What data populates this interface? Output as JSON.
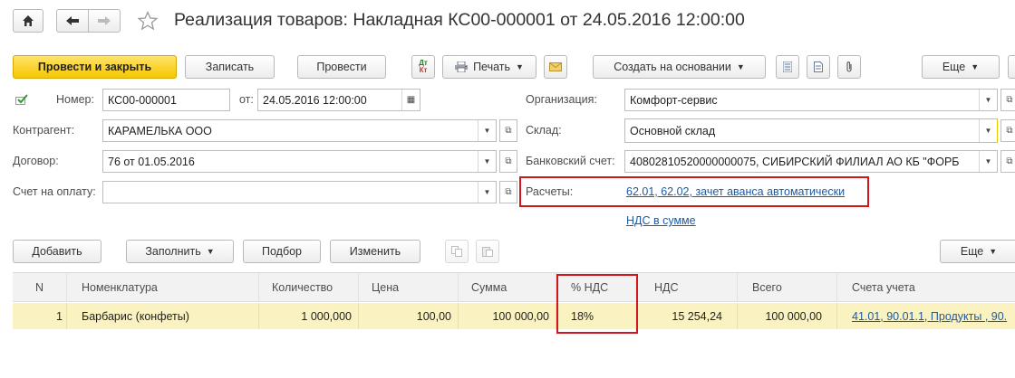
{
  "window": {
    "title": "Реализация товаров: Накладная КС00-000001 от 24.05.2016 12:00:00"
  },
  "toolbar": {
    "post_close": "Провести и закрыть",
    "save": "Записать",
    "post": "Провести",
    "dt_kt": "Дт Кт",
    "print": "Печать",
    "create_based": "Создать на основании",
    "more": "Еще"
  },
  "header": {
    "number_label": "Номер:",
    "number_value": "КС00-000001",
    "date_label": "от:",
    "date_value": "24.05.2016 12:00:00",
    "contractor_label": "Контрагент:",
    "contractor_value": "КАРАМЕЛЬКА ООО",
    "contract_label": "Договор:",
    "contract_value": "76 от 01.05.2016",
    "invoice_label": "Счет на оплату:",
    "invoice_value": "",
    "org_label": "Организация:",
    "org_value": "Комфорт-сервис",
    "warehouse_label": "Склад:",
    "warehouse_value": "Основной склад",
    "bank_label": "Банковский счет:",
    "bank_value": "40802810520000000075, СИБИРСКИЙ ФИЛИАЛ АО КБ \"ФОРБ",
    "settlements_label": "Расчеты:",
    "settlements_link": "62.01, 62.02, зачет аванса автоматически",
    "vat_link": "НДС в сумме"
  },
  "table_toolbar": {
    "add": "Добавить",
    "fill": "Заполнить",
    "select": "Подбор",
    "change": "Изменить",
    "more": "Еще"
  },
  "table": {
    "columns": [
      "N",
      "Номенклатура",
      "Количество",
      "Цена",
      "Сумма",
      "% НДС",
      "НДС",
      "Всего",
      "Счета учета"
    ],
    "rows": [
      {
        "n": "1",
        "item": "Барбарис (конфеты)",
        "qty": "1 000,000",
        "price": "100,00",
        "sum": "100 000,00",
        "vat_rate": "18%",
        "vat": "15 254,24",
        "total": "100 000,00",
        "accounts": "41.01, 90.01.1, Продукты , 90."
      }
    ]
  },
  "colors": {
    "primary_button": "#f6c700",
    "highlight_box": "#d3151c",
    "selected_row": "#fbf2c2",
    "link": "#1c5aa3"
  }
}
